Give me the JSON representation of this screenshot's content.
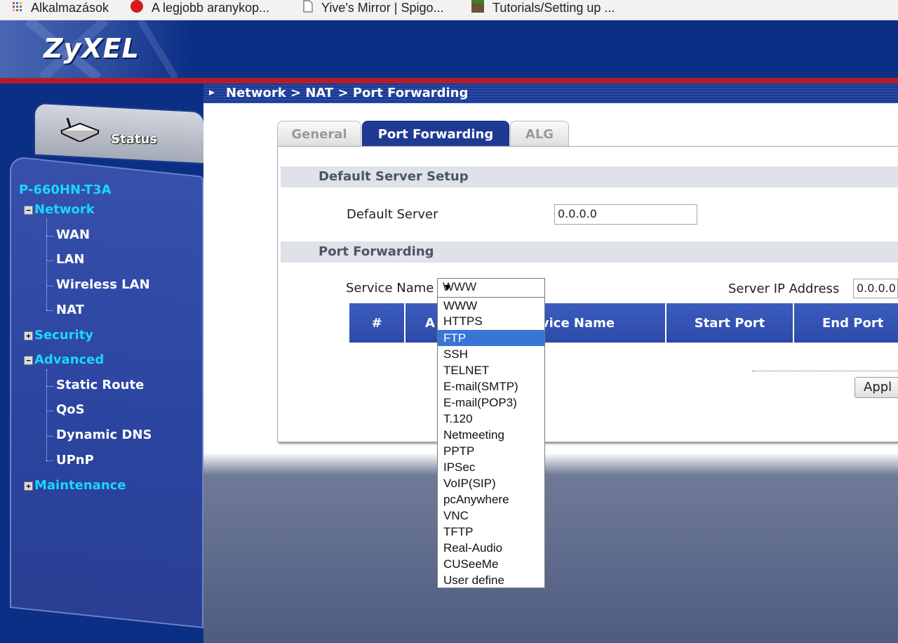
{
  "bookmarks": [
    {
      "label": "Alkalmazások",
      "icon": "apps-grid-icon"
    },
    {
      "label": "A legjobb aranykop...",
      "icon": "red-circle-icon"
    },
    {
      "label": "Yive's Mirror | Spigo...",
      "icon": "page-icon"
    },
    {
      "label": "Tutorials/Setting up ...",
      "icon": "block-icon"
    }
  ],
  "header": {
    "logo": "ZyXEL"
  },
  "sidebar": {
    "status_label": "Status",
    "device_model": "P-660HN-T3A",
    "groups": [
      {
        "label": "Network",
        "expanded": true,
        "items": [
          "WAN",
          "LAN",
          "Wireless LAN",
          "NAT"
        ]
      },
      {
        "label": "Security",
        "expanded": false,
        "items": []
      },
      {
        "label": "Advanced",
        "expanded": true,
        "items": [
          "Static Route",
          "QoS",
          "Dynamic DNS",
          "UPnP"
        ]
      },
      {
        "label": "Maintenance",
        "expanded": false,
        "items": []
      }
    ]
  },
  "breadcrumb": "Network > NAT > Port Forwarding",
  "tabs": [
    {
      "label": "General",
      "active": false
    },
    {
      "label": "Port Forwarding",
      "active": true
    },
    {
      "label": "ALG",
      "active": false
    }
  ],
  "default_server_section": {
    "title": "Default Server Setup",
    "field_label": "Default Server",
    "field_value": "0.0.0.0"
  },
  "port_forwarding_section": {
    "title": "Port Forwarding",
    "service_name_label": "Service Name",
    "service_name_value": "WWW",
    "server_ip_label": "Server IP Address",
    "server_ip_value": "0.0.0.0",
    "table_headers": [
      "#",
      "A",
      "rvice Name",
      "Start Port",
      "End Port"
    ],
    "apply_label": "Appl"
  },
  "dropdown": {
    "options": [
      "WWW",
      "HTTPS",
      "FTP",
      "SSH",
      "TELNET",
      "E-mail(SMTP)",
      "E-mail(POP3)",
      "T.120",
      "Netmeeting",
      "PPTP",
      "IPSec",
      "VoIP(SIP)",
      "pcAnywhere",
      "VNC",
      "TFTP",
      "Real-Audio",
      "CUSeeMe",
      "User define"
    ],
    "highlighted": "FTP"
  },
  "colors": {
    "header_bg": "#0c2f86",
    "accent_red": "#b01e2e",
    "nav_top": "#19d7ff",
    "tab_active": "#1f3a93",
    "highlight": "#3875d7"
  }
}
